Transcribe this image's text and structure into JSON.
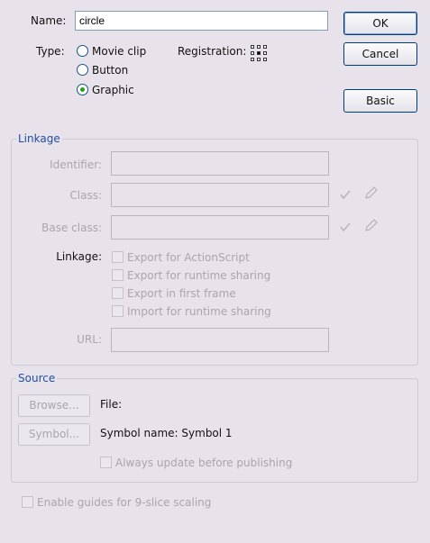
{
  "name": {
    "label": "Name:",
    "value": "circle"
  },
  "type": {
    "label": "Type:",
    "options": [
      "Movie clip",
      "Button",
      "Graphic"
    ],
    "selected": "Graphic"
  },
  "registration": {
    "label": "Registration:"
  },
  "buttons": {
    "ok": "OK",
    "cancel": "Cancel",
    "basic": "Basic"
  },
  "linkage": {
    "legend": "Linkage",
    "identifier_label": "Identifier:",
    "class_label": "Class:",
    "base_class_label": "Base class:",
    "linkage_label": "Linkage:",
    "checkboxes": [
      "Export for ActionScript",
      "Export for runtime sharing",
      "Export in first frame",
      "Import for runtime sharing"
    ],
    "url_label": "URL:"
  },
  "source": {
    "legend": "Source",
    "browse": "Browse...",
    "file_label": "File:",
    "symbol": "Symbol...",
    "symbol_name": "Symbol name: Symbol 1",
    "always_update": "Always update before publishing"
  },
  "guides": "Enable guides for 9-slice scaling",
  "icons": {
    "check": "checkmark-icon",
    "edit": "pencil-icon",
    "registration": "registration-grid-icon"
  },
  "colors": {
    "accent": "#1f4fa0",
    "selected_radio": "#21a121"
  }
}
